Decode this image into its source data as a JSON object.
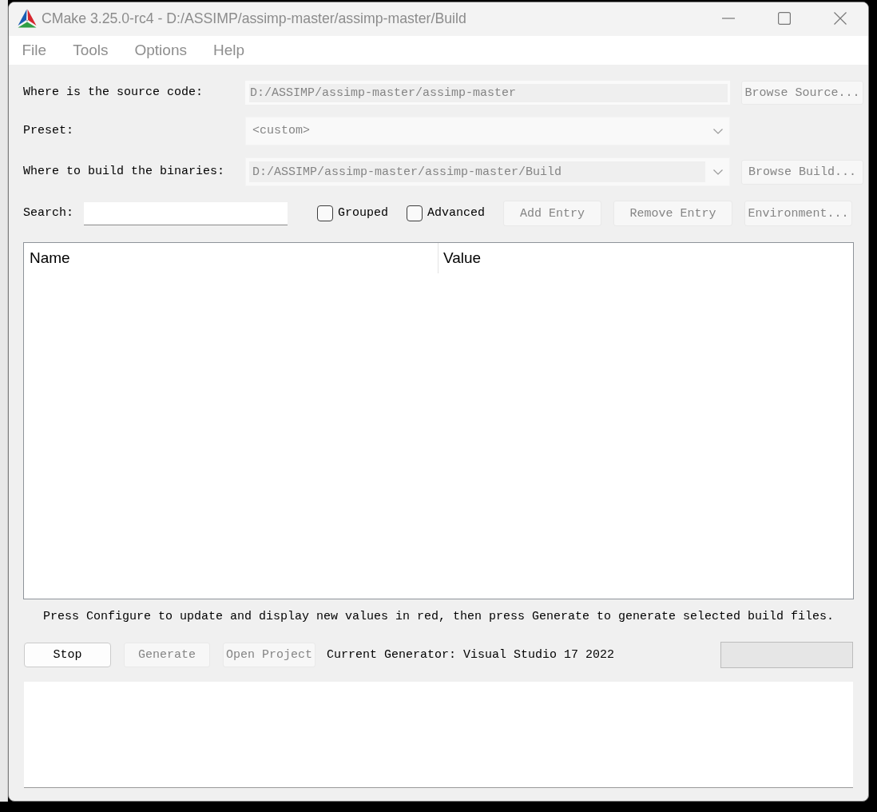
{
  "window": {
    "title": "CMake 3.25.0-rc4 - D:/ASSIMP/assimp-master/assimp-master/Build"
  },
  "menu": [
    "File",
    "Tools",
    "Options",
    "Help"
  ],
  "source": {
    "label": "Where is the source code:",
    "value": "D:/ASSIMP/assimp-master/assimp-master",
    "disabled": true,
    "button": {
      "label": "Browse Source...",
      "disabled": true
    }
  },
  "preset": {
    "label": "Preset:",
    "value": "<custom>",
    "disabled": true
  },
  "build": {
    "label": "Where to build the binaries:",
    "value": "D:/ASSIMP/assimp-master/assimp-master/Build",
    "disabled": true,
    "button": {
      "label": "Browse Build...",
      "disabled": true
    }
  },
  "search": {
    "label": "Search:"
  },
  "options": [
    {
      "label": "Grouped",
      "checked": false
    },
    {
      "label": "Advanced",
      "checked": false
    }
  ],
  "entry_buttons": [
    {
      "label": "Add Entry",
      "disabled": true
    },
    {
      "label": "Remove Entry",
      "disabled": true
    },
    {
      "label": "Environment...",
      "disabled": true
    }
  ],
  "table": {
    "columns": [
      "Name",
      "Value"
    ]
  },
  "message": "Press Configure to update and display new values in red, then press Generate to generate selected build files.",
  "actions": [
    {
      "label": "Stop",
      "disabled": false
    },
    {
      "label": "Generate",
      "disabled": true
    },
    {
      "label": "Open Project",
      "disabled": true
    }
  ],
  "generator": "Current Generator: Visual Studio 17 2022",
  "progress": {
    "level": 0
  }
}
